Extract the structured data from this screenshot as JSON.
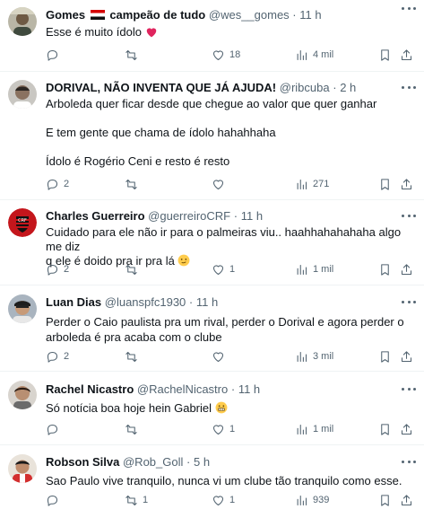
{
  "tweets": [
    {
      "name": "Gomes",
      "name_suffix": "campeão de tudo",
      "handle": "@wes__gomes",
      "time": "11 h",
      "lines": [
        "Esse é muito ídolo"
      ],
      "replies": "",
      "retweets": "",
      "likes": "18",
      "views": "4 mil"
    },
    {
      "name": "DORIVAL, NÃO INVENTA QUE JÁ AJUDA!",
      "handle": "@ribcuba",
      "time": "2 h",
      "lines": [
        "Arboleda quer ficar desde que chegue ao valor que quer ganhar",
        "",
        "E tem gente que chama de ídolo hahahhaha",
        "",
        "Ídolo é Rogério Ceni e resto é resto"
      ],
      "replies": "2",
      "retweets": "",
      "likes": "",
      "views": "271"
    },
    {
      "name": "Charles Guerreiro",
      "handle": "@guerreiroCRF",
      "time": "11 h",
      "lines": [
        "Cuidado para ele não ir para o palmeiras viu.. haahhahahahaha algo me diz",
        "q ele é doido pra ir pra lá"
      ],
      "replies": "2",
      "retweets": "",
      "likes": "1",
      "views": "1 mil"
    },
    {
      "name": "Luan Dias",
      "handle": "@luanspfc1930",
      "time": "11 h",
      "lines": [
        "Perder o Caio paulista pra um rival, perder o Dorival e agora perder o",
        "arboleda é pra acaba com o clube"
      ],
      "replies": "2",
      "retweets": "",
      "likes": "",
      "views": "3 mil"
    },
    {
      "name": "Rachel Nicastro",
      "handle": "@RachelNicastro",
      "time": "11 h",
      "lines": [
        "Só notícia boa hoje hein Gabriel"
      ],
      "replies": "",
      "retweets": "",
      "likes": "1",
      "views": "1 mil"
    },
    {
      "name": "Robson Silva",
      "handle": "@Rob_Goll",
      "time": "5 h",
      "lines": [
        "Sao Paulo vive tranquilo, nunca vi um clube tão tranquilo como esse."
      ],
      "replies": "",
      "retweets": "1",
      "likes": "1",
      "views": "939"
    }
  ],
  "separator": "·",
  "colors": {
    "text": "#0f1419",
    "secondary": "#536471",
    "divider": "#eff3f4",
    "heart": "#f91880"
  },
  "icons": {
    "reply": "reply-icon",
    "retweet": "retweet-icon",
    "like": "like-icon",
    "views": "views-icon",
    "bookmark": "bookmark-icon",
    "share": "share-icon",
    "more": "more-icon"
  }
}
